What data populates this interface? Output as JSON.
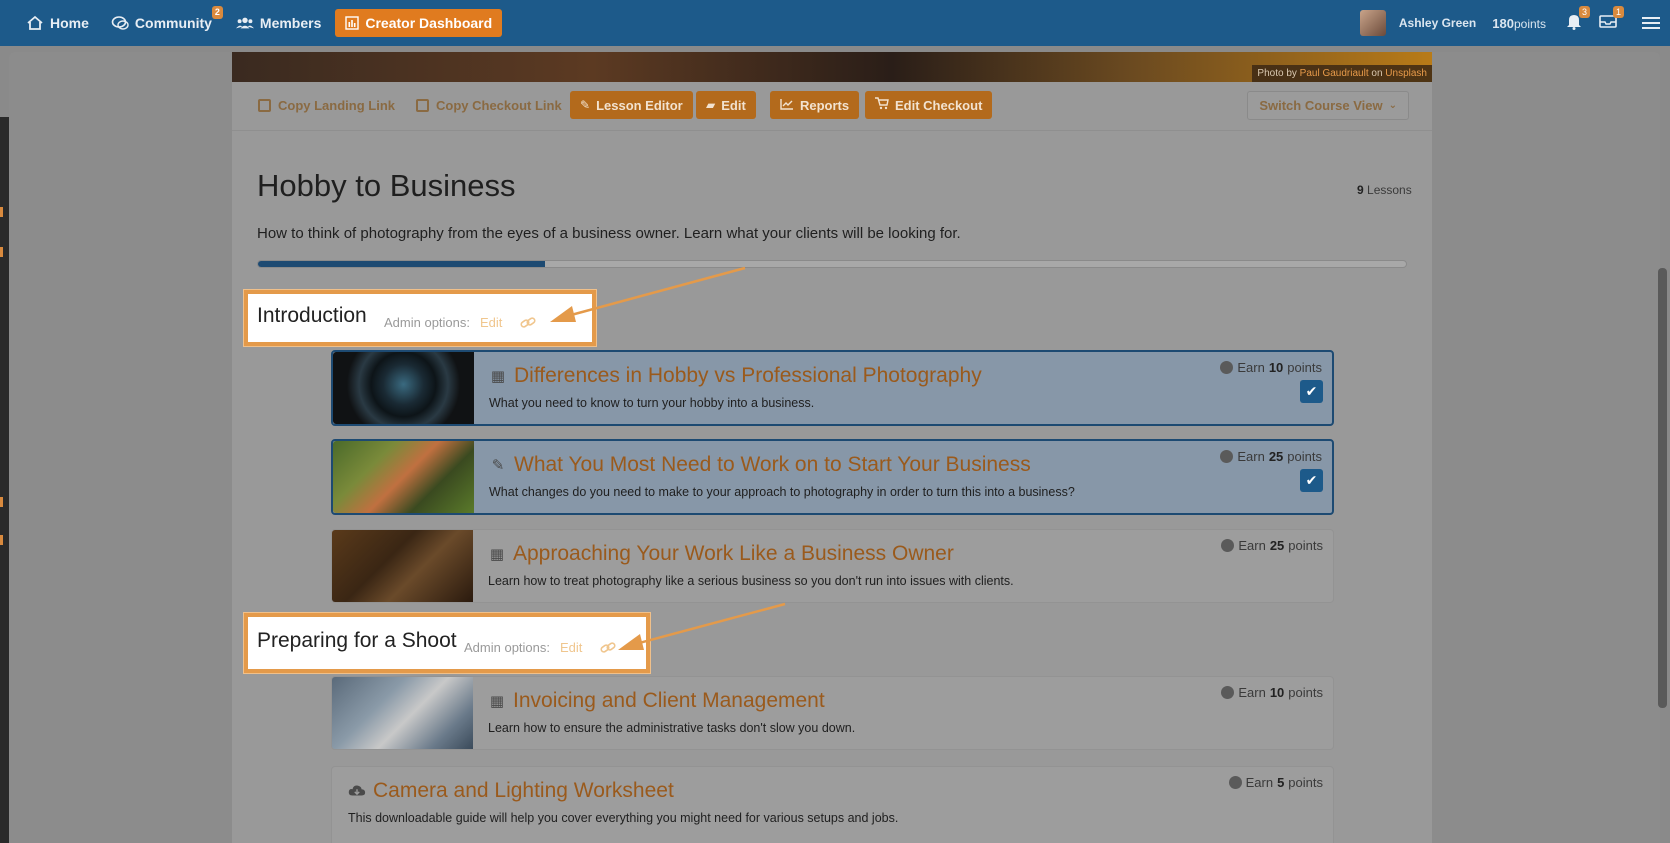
{
  "nav": {
    "home": "Home",
    "community": "Community",
    "community_badge": "2",
    "members": "Members",
    "creator": "Creator Dashboard",
    "user_name": "Ashley Green",
    "points_value": "180",
    "points_label": "points",
    "notif_badge": "3",
    "msg_badge": "1"
  },
  "hero": {
    "credit_prefix": "Photo by",
    "credit_author": "Paul Gaudriault",
    "credit_on": "on",
    "credit_site": "Unsplash"
  },
  "toolbar": {
    "copy_landing": "Copy Landing Link",
    "copy_checkout": "Copy Checkout Link",
    "lesson_editor": "Lesson Editor",
    "edit": "Edit",
    "reports": "Reports",
    "edit_checkout": "Edit Checkout",
    "switch_view": "Switch Course View"
  },
  "course": {
    "title": "Hobby to Business",
    "lessons_count": "9",
    "lessons_label": "Lessons",
    "description": "How to think of photography from the eyes of a business owner. Learn what your clients will be looking for.",
    "progress": 0.25
  },
  "sections": [
    {
      "title": "Introduction",
      "admin_label": "Admin options:",
      "edit_label": "Edit"
    },
    {
      "title": "Preparing for a Shoot",
      "admin_label": "Admin options:",
      "edit_label": "Edit"
    }
  ],
  "lessons": [
    {
      "title": "Differences in Hobby vs Professional Photography",
      "description": "What you need to know to turn your hobby into a business.",
      "earn_prefix": "Earn",
      "points": "10",
      "earn_suffix": "points",
      "icon": "film-icon",
      "completed": true
    },
    {
      "title": "What You Most Need to Work on to Start Your Business",
      "description": "What changes do you need to make to your approach to photography in order to turn this into a business?",
      "earn_prefix": "Earn",
      "points": "25",
      "earn_suffix": "points",
      "icon": "pencil-icon",
      "completed": true
    },
    {
      "title": "Approaching Your Work Like a Business Owner",
      "description": "Learn how to treat photography like a serious business so you don't run into issues with clients.",
      "earn_prefix": "Earn",
      "points": "25",
      "earn_suffix": "points",
      "icon": "film-icon",
      "completed": false
    },
    {
      "title": "Invoicing and Client Management",
      "description": "Learn how to ensure the administrative tasks don't slow you down.",
      "earn_prefix": "Earn",
      "points": "10",
      "earn_suffix": "points",
      "icon": "film-icon",
      "completed": false
    },
    {
      "title": "Camera and Lighting Worksheet",
      "description": "This downloadable guide will help you cover everything you might need for various setups and jobs.",
      "earn_prefix": "Earn",
      "points": "5",
      "earn_suffix": "points",
      "icon": "download-icon",
      "completed": false
    }
  ],
  "colors": {
    "nav_bg": "#1d5a8a",
    "accent": "#e07b1f",
    "highlight_border": "#e49a4a"
  }
}
